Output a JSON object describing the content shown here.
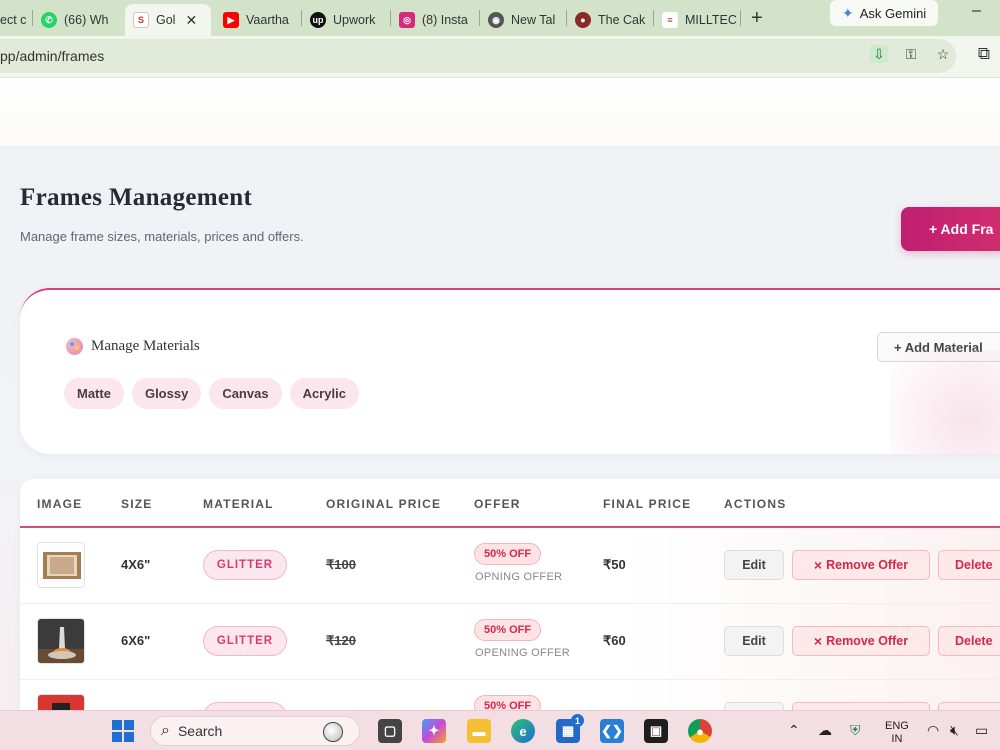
{
  "browser": {
    "tabs": [
      {
        "label": "ect c",
        "favicon": "generic-tab-icon",
        "color": "#888888"
      },
      {
        "label": "(66) Wh",
        "favicon": "whatsapp-icon",
        "color": "#25D366"
      },
      {
        "label": "Gol",
        "favicon": "site-logo-icon",
        "color": "#c0392b",
        "active": true
      },
      {
        "label": "Vaartha",
        "favicon": "youtube-icon",
        "color": "#ff0000"
      },
      {
        "label": "Upwork",
        "favicon": "upwork-icon",
        "color": "#111111"
      },
      {
        "label": "(8) Insta",
        "favicon": "instagram-icon",
        "color": "#d6297a"
      },
      {
        "label": "New Tal",
        "favicon": "chrome-icon",
        "color": "#555555"
      },
      {
        "label": "The Cak",
        "favicon": "cake-icon",
        "color": "#8b2a2a"
      },
      {
        "label": "MILLTEC",
        "favicon": "milltec-icon",
        "color": "#c0392b"
      }
    ],
    "new_tab_symbol": "+",
    "gemini_label": "Ask Gemini",
    "minimize_symbol": "–",
    "address": "pp/admin/frames"
  },
  "page": {
    "title": "Frames Management",
    "subtitle": "Manage frame sizes, materials, prices and offers.",
    "add_frame_label": "+ Add Fra"
  },
  "materials": {
    "title": "Manage Materials",
    "add_label": "+ Add Material",
    "items": [
      "Matte",
      "Glossy",
      "Canvas",
      "Acrylic"
    ]
  },
  "table": {
    "headers": [
      "IMAGE",
      "SIZE",
      "MATERIAL",
      "ORIGINAL PRICE",
      "OFFER",
      "FINAL PRICE",
      "ACTIONS"
    ],
    "rows": [
      {
        "size": "4X6\"",
        "material": "GLITTER",
        "original_price": "₹100",
        "offer": "50% OFF",
        "offer_label": "OPNING OFFER",
        "final_price": "₹50",
        "edit": "Edit",
        "remove_offer": "Remove Offer",
        "delete": "Delete"
      },
      {
        "size": "6X6\"",
        "material": "GLITTER",
        "original_price": "₹120",
        "offer": "50% OFF",
        "offer_label": "OPENING OFFER",
        "final_price": "₹60",
        "edit": "Edit",
        "remove_offer": "Remove Offer",
        "delete": "Delete"
      },
      {
        "offer": "50% OFF"
      }
    ],
    "remove_icon": "×"
  },
  "taskbar": {
    "search_label": "Search",
    "store_badge": "1",
    "lang_line1": "ENG",
    "lang_line2": "IN"
  },
  "colors": {
    "accent": "#c01e70",
    "chip_bg": "#fbe6ee",
    "danger": "#d4284a"
  }
}
